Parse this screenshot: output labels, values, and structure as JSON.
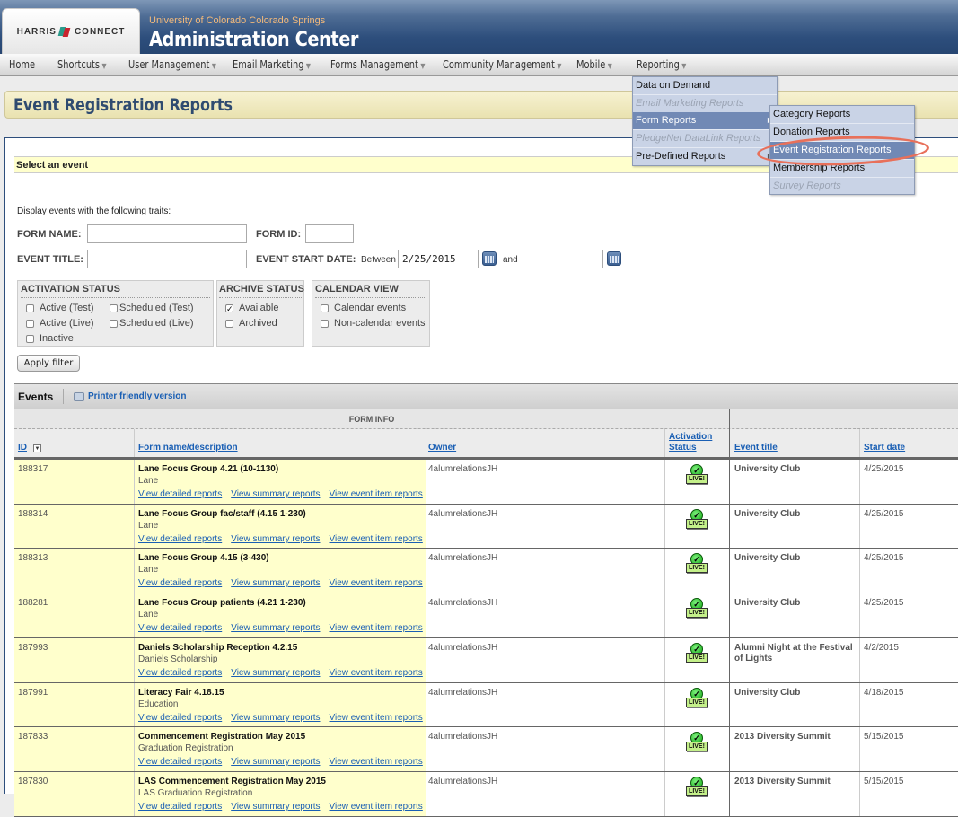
{
  "header": {
    "logo_left": "HARRIS",
    "logo_right": "CONNECT",
    "subtitle": "University of Colorado Colorado Springs",
    "title": "Administration Center"
  },
  "nav": {
    "items": [
      {
        "label": "Home",
        "has_caret": false
      },
      {
        "label": "Shortcuts",
        "has_caret": true
      },
      {
        "label": "User Management",
        "has_caret": true
      },
      {
        "label": "Email Marketing",
        "has_caret": true
      },
      {
        "label": "Forms Management",
        "has_caret": true
      },
      {
        "label": "Community Management",
        "has_caret": true
      },
      {
        "label": "Mobile",
        "has_caret": true
      },
      {
        "label": "Reporting",
        "has_caret": true
      }
    ],
    "caret": "▼"
  },
  "reporting_menu": {
    "items": [
      {
        "label": "Data on Demand",
        "state": "normal"
      },
      {
        "label": "Email Marketing Reports",
        "state": "disabled"
      },
      {
        "label": "Form Reports",
        "state": "active"
      },
      {
        "label": "PledgeNet DataLink Reports",
        "state": "disabled"
      },
      {
        "label": "Pre-Defined Reports",
        "state": "normal"
      }
    ],
    "submenu_arrow": "▶"
  },
  "form_reports_submenu": {
    "items": [
      {
        "label": "Category Reports",
        "state": "normal"
      },
      {
        "label": "Donation Reports",
        "state": "normal"
      },
      {
        "label": "Event Registration Reports",
        "state": "active"
      },
      {
        "label": "Membership Reports",
        "state": "normal"
      },
      {
        "label": "Survey Reports",
        "state": "disabled"
      }
    ]
  },
  "page": {
    "title": "Event Registration Reports",
    "section_title": "Select an event",
    "traits_label": "Display events with the following traits:"
  },
  "filters": {
    "form_name_label": "FORM NAME:",
    "form_name_value": "",
    "form_id_label": "FORM ID:",
    "form_id_value": "",
    "event_title_label": "EVENT TITLE:",
    "event_title_value": "",
    "event_start_label": "EVENT START DATE:",
    "between_label": "Between",
    "start_from": "2/25/2015",
    "and_label": "and",
    "start_to": "",
    "activation": {
      "title": "ACTIVATION STATUS",
      "options": [
        {
          "label": "Active (Test)",
          "checked": false
        },
        {
          "label": "Scheduled (Test)",
          "checked": false
        },
        {
          "label": "Active (Live)",
          "checked": false
        },
        {
          "label": "Scheduled (Live)",
          "checked": false
        },
        {
          "label": "Inactive",
          "checked": false
        }
      ]
    },
    "archive": {
      "title": "ARCHIVE STATUS",
      "options": [
        {
          "label": "Available",
          "checked": true
        },
        {
          "label": "Archived",
          "checked": false
        }
      ]
    },
    "calendar": {
      "title": "CALENDAR VIEW",
      "options": [
        {
          "label": "Calendar events",
          "checked": false
        },
        {
          "label": "Non-calendar events",
          "checked": false
        }
      ]
    },
    "apply_label": "Apply filter"
  },
  "events": {
    "title": "Events",
    "printer_link": "Printer friendly version",
    "group_header": "FORM INFO",
    "columns": {
      "id": "ID",
      "form": "Form name/description",
      "owner": "Owner",
      "activation_1": "Activation",
      "activation_2": "Status",
      "event_title": "Event title",
      "start_date": "Start date"
    },
    "link_labels": [
      "View detailed reports",
      "View summary reports",
      "View event item reports"
    ],
    "live_label": "LIVE!",
    "rows": [
      {
        "id": "188317",
        "name": "Lane Focus Group 4.21 (10-1130)",
        "desc": "Lane",
        "owner": "4alumrelationsJH",
        "status": "live",
        "event_title": "University Club",
        "start_date": "4/25/2015"
      },
      {
        "id": "188314",
        "name": "Lane Focus Group fac/staff (4.15 1-230)",
        "desc": "Lane",
        "owner": "4alumrelationsJH",
        "status": "live",
        "event_title": "University Club",
        "start_date": "4/25/2015"
      },
      {
        "id": "188313",
        "name": "Lane Focus Group 4.15 (3-430)",
        "desc": "Lane",
        "owner": "4alumrelationsJH",
        "status": "live",
        "event_title": "University Club",
        "start_date": "4/25/2015"
      },
      {
        "id": "188281",
        "name": "Lane Focus Group patients (4.21 1-230)",
        "desc": "Lane",
        "owner": "4alumrelationsJH",
        "status": "live",
        "event_title": "University Club",
        "start_date": "4/25/2015"
      },
      {
        "id": "187993",
        "name": "Daniels Scholarship Reception 4.2.15",
        "desc": "Daniels Scholarship",
        "owner": "4alumrelationsJH",
        "status": "live",
        "event_title": "Alumni Night at the Festival of Lights",
        "start_date": "4/2/2015"
      },
      {
        "id": "187991",
        "name": "Literacy Fair 4.18.15",
        "desc": "Education",
        "owner": "4alumrelationsJH",
        "status": "live",
        "event_title": "University Club",
        "start_date": "4/18/2015"
      },
      {
        "id": "187833",
        "name": "Commencement Registration May 2015",
        "desc": "Graduation Registration",
        "owner": "4alumrelationsJH",
        "status": "live",
        "event_title": "2013 Diversity Summit",
        "start_date": "5/15/2015"
      },
      {
        "id": "187830",
        "name": "LAS Commencement Registration May 2015",
        "desc": "LAS Graduation Registration",
        "owner": "4alumrelationsJH",
        "status": "live",
        "event_title": "2013 Diversity Summit",
        "start_date": "5/15/2015"
      }
    ]
  }
}
